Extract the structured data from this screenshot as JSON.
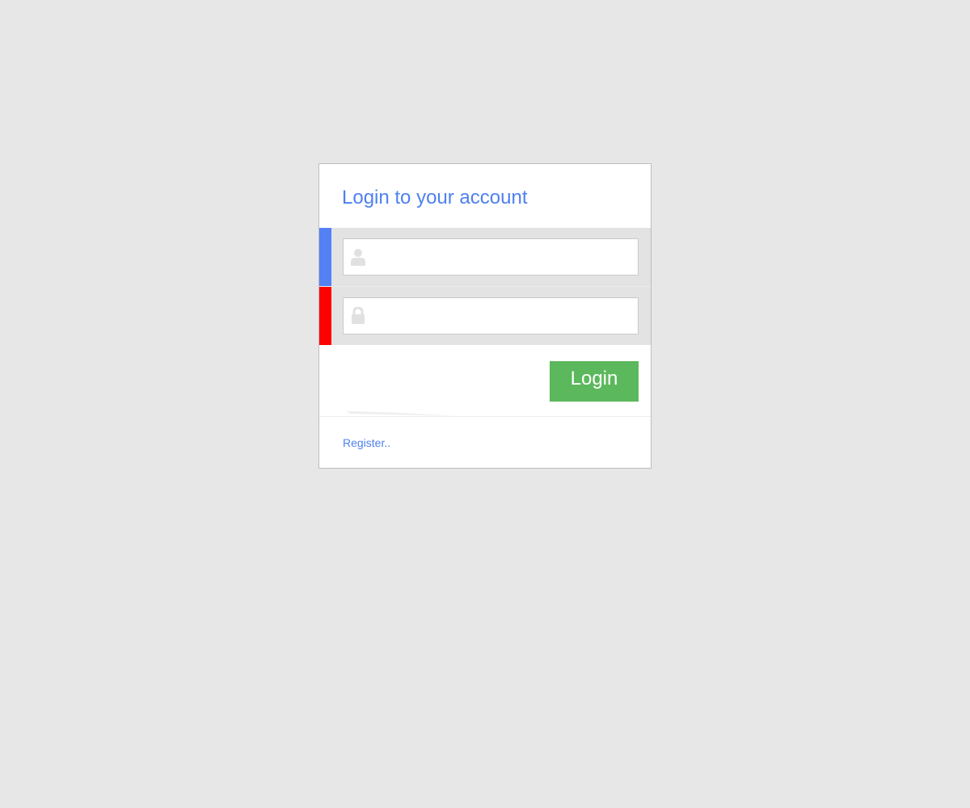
{
  "login_form": {
    "title": "Login to your account",
    "username": {
      "icon": "user-icon",
      "placeholder": "",
      "value": "",
      "accent_color": "#5480f6"
    },
    "password": {
      "icon": "lock-icon",
      "placeholder": "",
      "value": "",
      "accent_color": "#ff0000"
    },
    "submit_label": "Login",
    "submit_color": "#5cb85c",
    "register_link": "Register.."
  }
}
